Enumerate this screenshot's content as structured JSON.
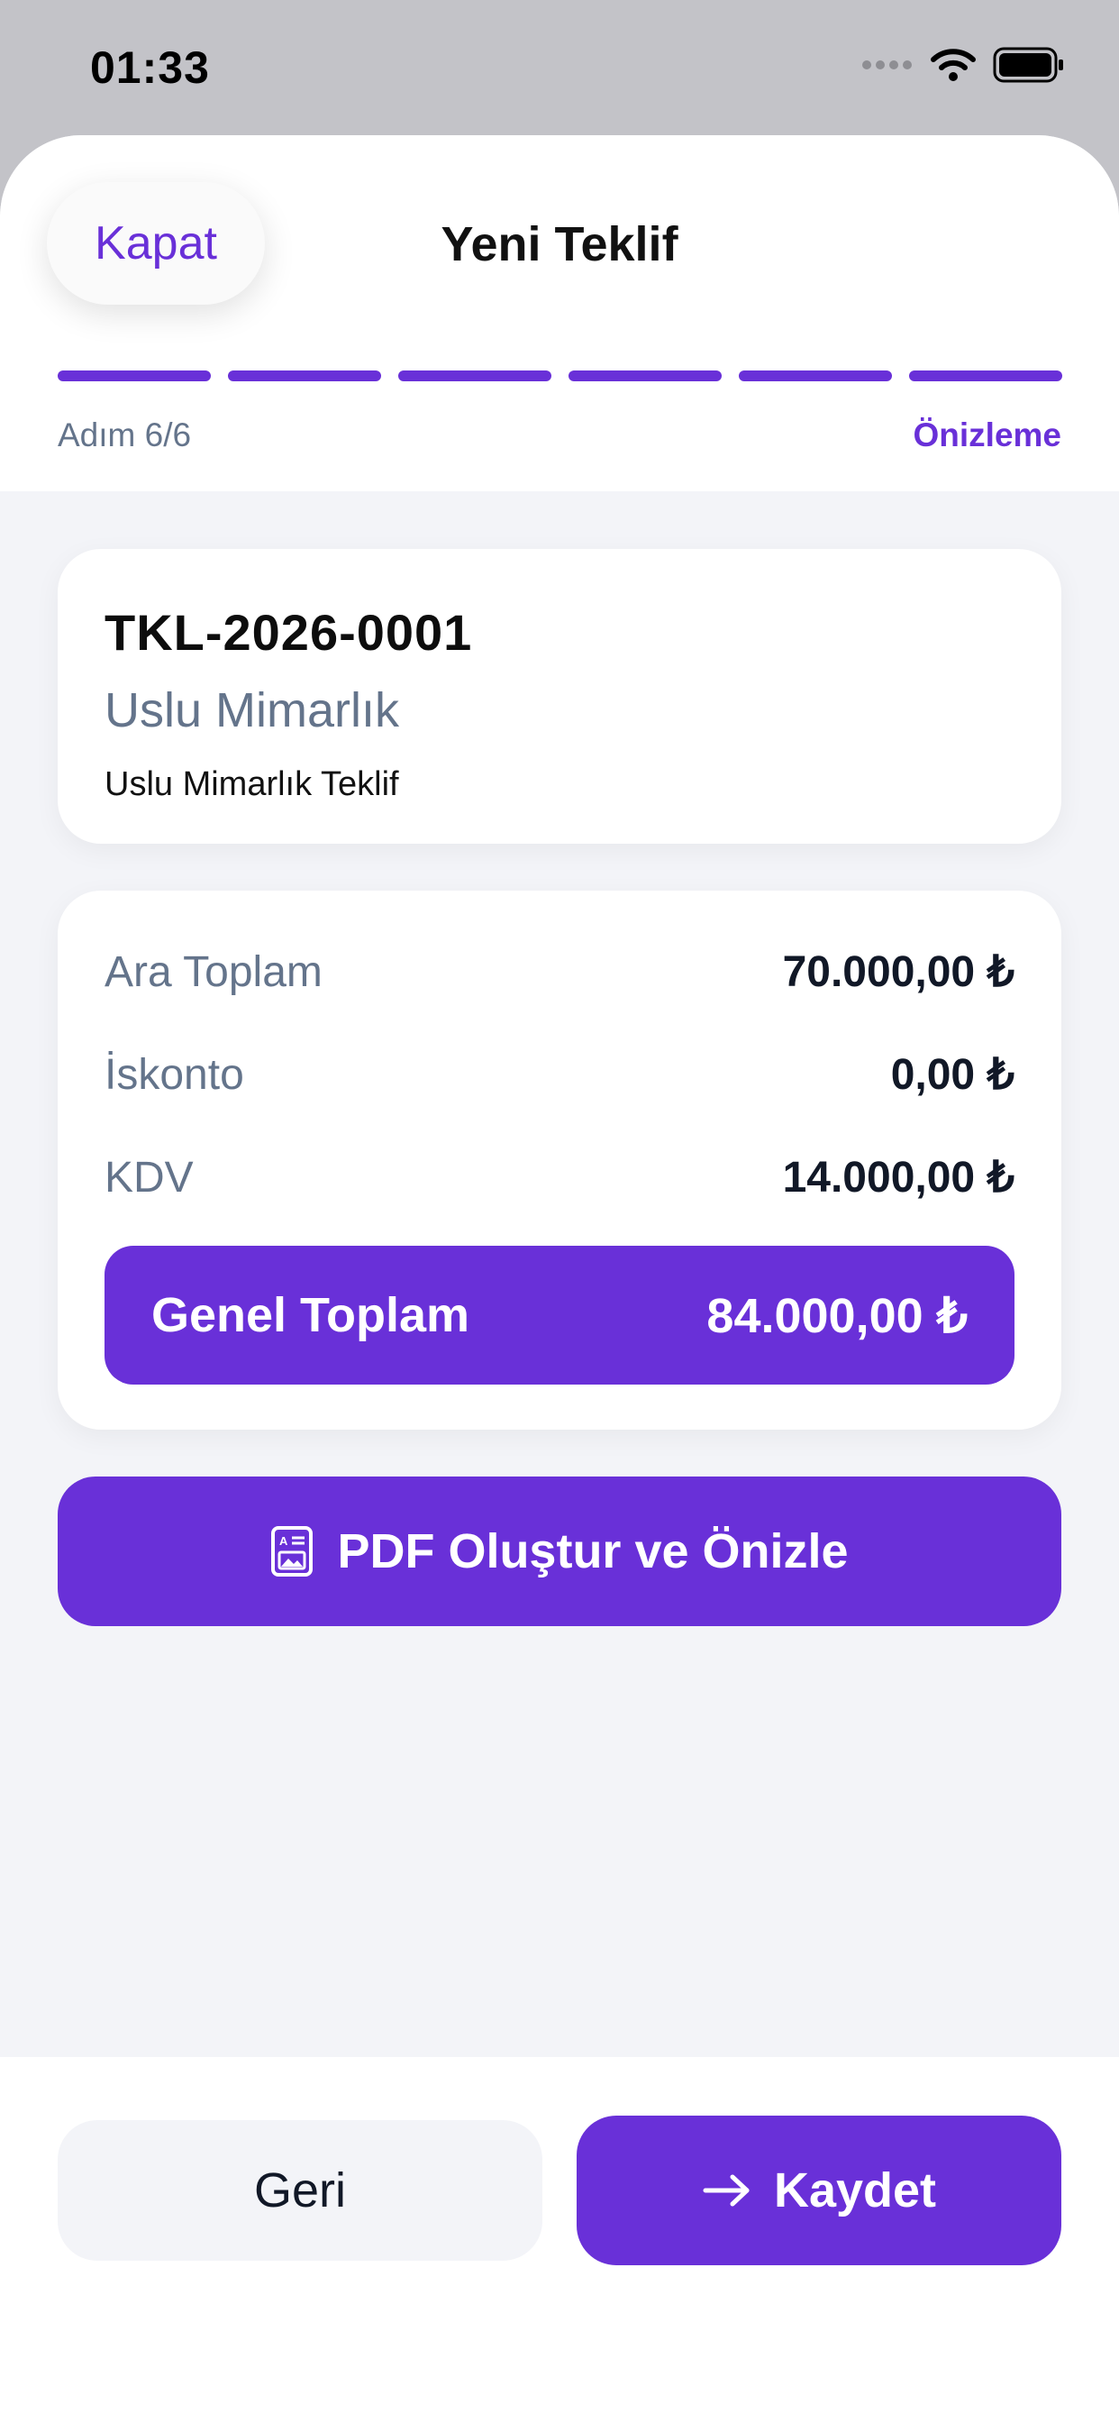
{
  "status_bar": {
    "time": "01:33"
  },
  "header": {
    "close_label": "Kapat",
    "title": "Yeni Teklif",
    "progress": {
      "total_steps": 6,
      "completed_steps": 6
    },
    "step_label": "Adım 6/6",
    "step_name": "Önizleme"
  },
  "quote": {
    "number": "TKL-2026-0001",
    "client": "Uslu Mimarlık",
    "title": "Uslu Mimarlık Teklif"
  },
  "summary": {
    "subtotal_label": "Ara Toplam",
    "subtotal_value": "70.000,00 ₺",
    "discount_label": "İskonto",
    "discount_value": "0,00 ₺",
    "vat_label": "KDV",
    "vat_value": "14.000,00 ₺",
    "total_label": "Genel Toplam",
    "total_value": "84.000,00 ₺"
  },
  "actions": {
    "pdf_label": "PDF Oluştur ve Önizle",
    "back_label": "Geri",
    "save_label": "Kaydet"
  },
  "colors": {
    "accent": "#6930d8",
    "muted_text": "#64748b",
    "background": "#f3f4f8"
  },
  "icons": [
    "signal-icon",
    "wifi-icon",
    "battery-icon",
    "document-icon",
    "arrow-right-icon"
  ]
}
